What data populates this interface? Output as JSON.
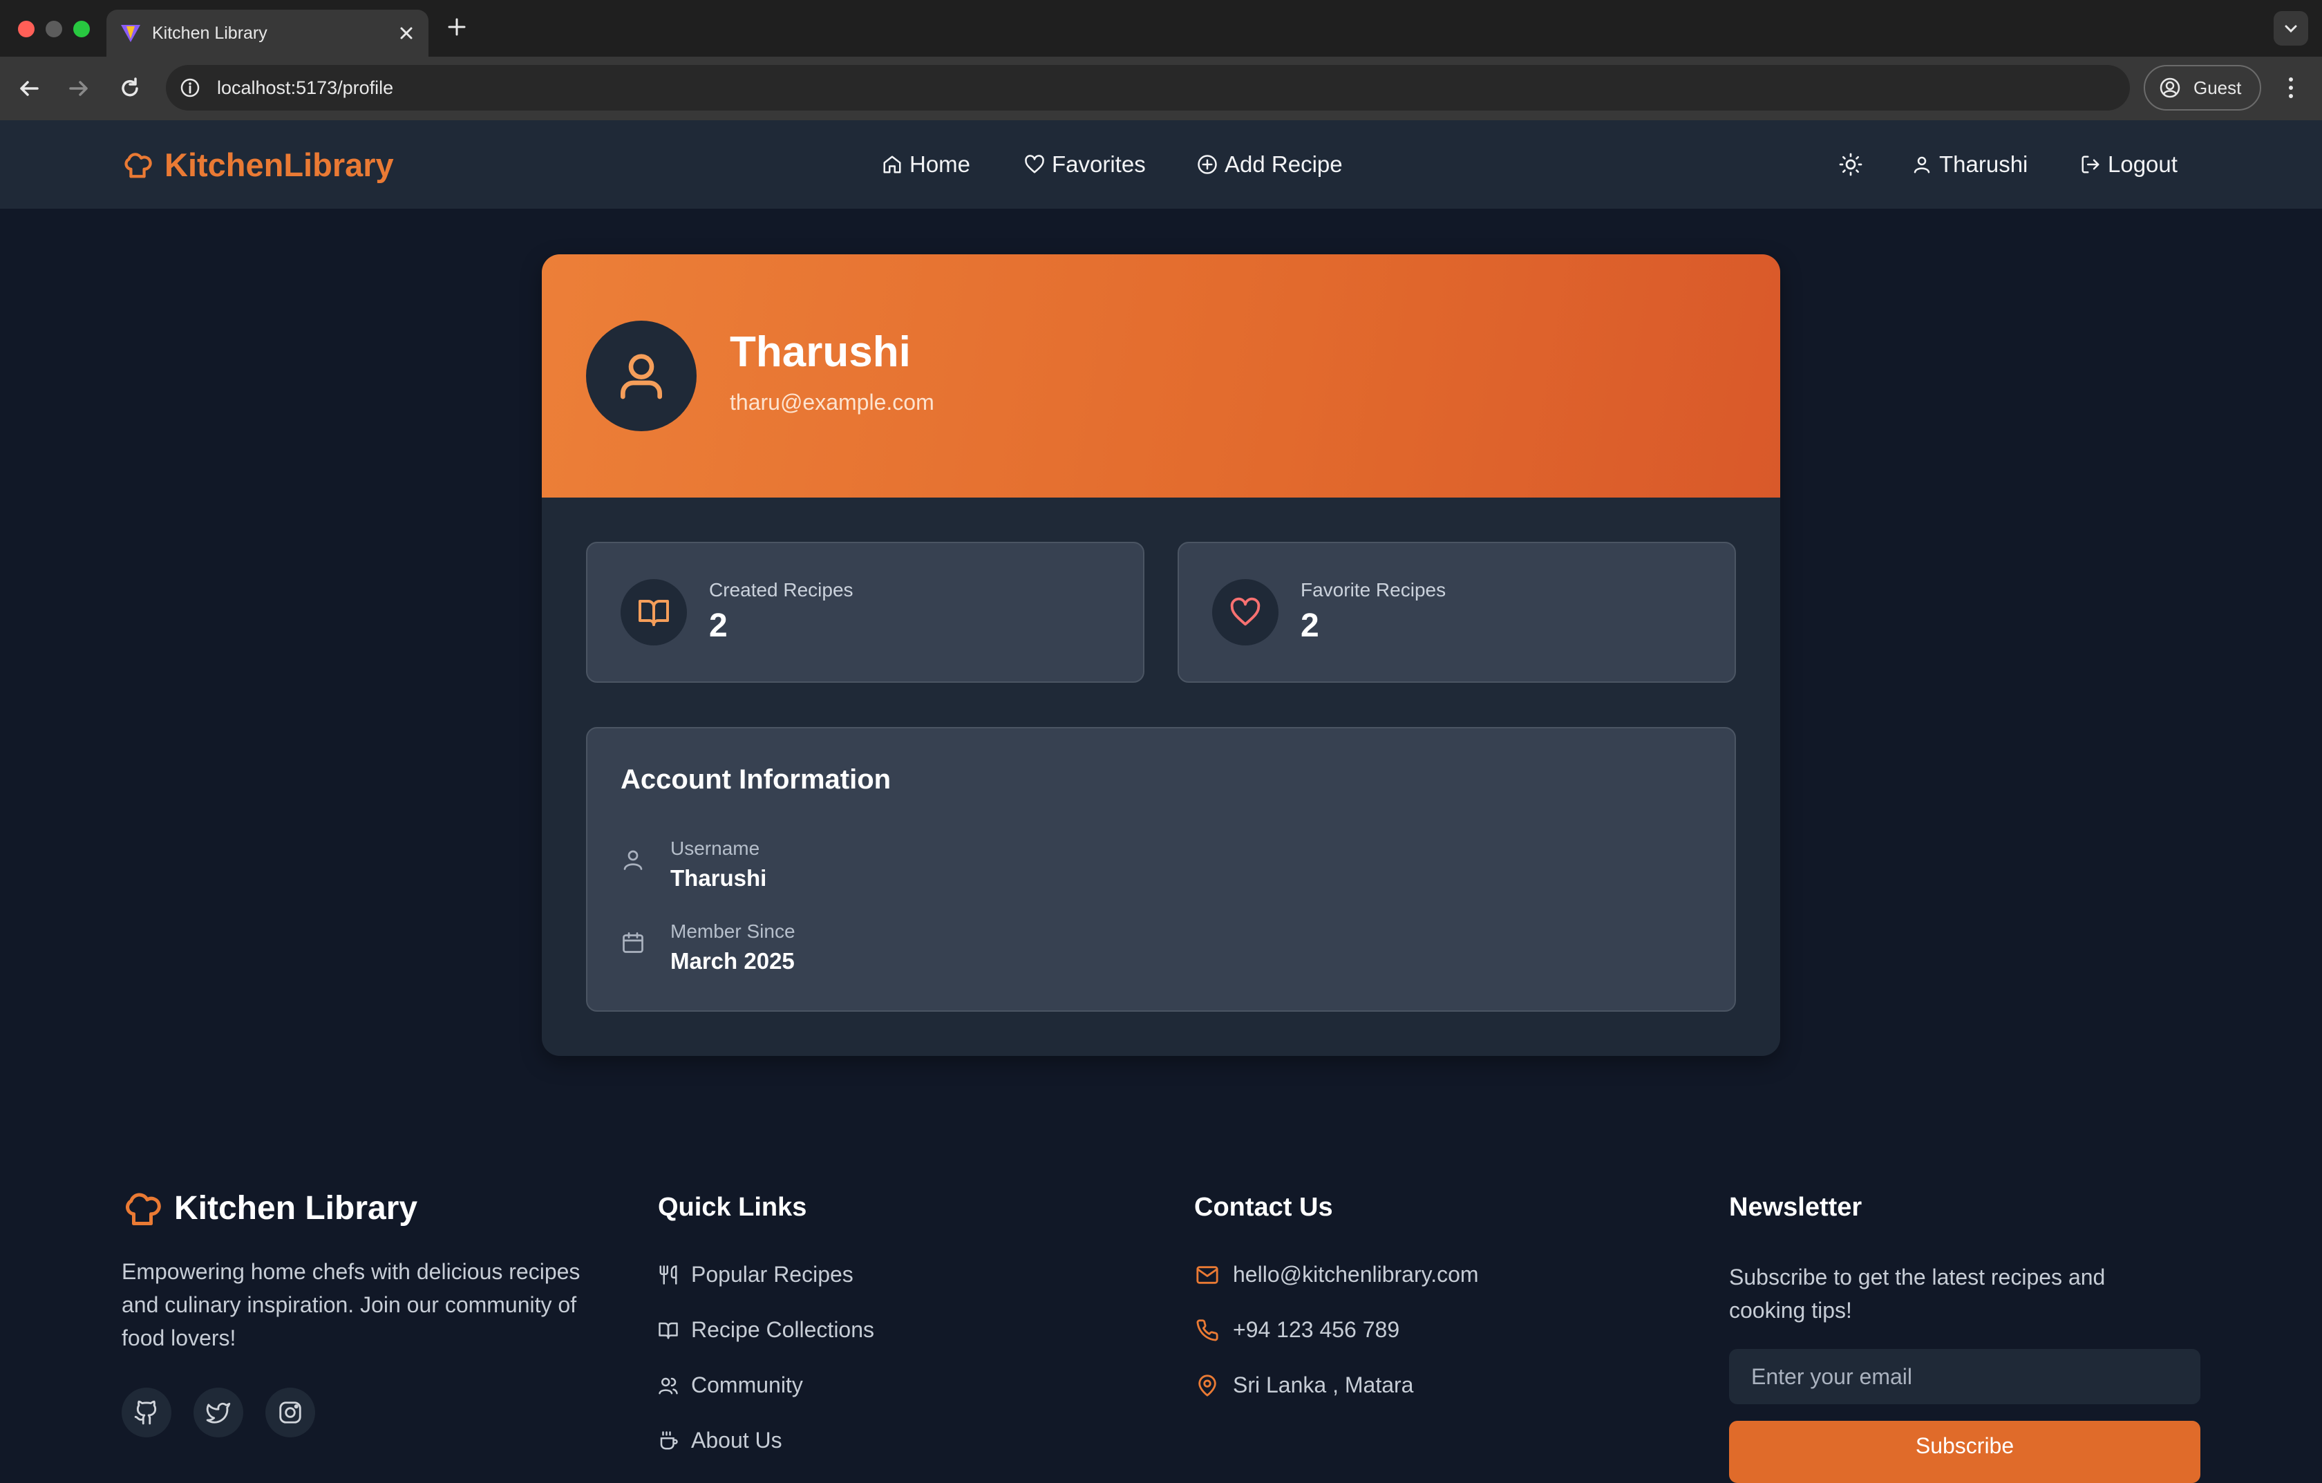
{
  "browser": {
    "tab_title": "Kitchen Library",
    "url": "localhost:5173/profile",
    "profile_label": "Guest"
  },
  "nav": {
    "brand": "KitchenLibrary",
    "links": [
      "Home",
      "Favorites",
      "Add Recipe"
    ],
    "user": "Tharushi",
    "logout": "Logout"
  },
  "profile": {
    "name": "Tharushi",
    "email": "tharu@example.com",
    "stats": [
      {
        "label": "Created Recipes",
        "value": "2"
      },
      {
        "label": "Favorite Recipes",
        "value": "2"
      }
    ],
    "account": {
      "title": "Account Information",
      "rows": [
        {
          "label": "Username",
          "value": "Tharushi"
        },
        {
          "label": "Member Since",
          "value": "March 2025"
        }
      ]
    }
  },
  "footer": {
    "brand": "Kitchen Library",
    "tagline_lines": [
      "Empowering home chefs with delicious recipes",
      "and culinary inspiration. Join our community of",
      "food lovers!"
    ],
    "quick_links": {
      "title": "Quick Links",
      "items": [
        "Popular Recipes",
        "Recipe Collections",
        "Community",
        "About Us"
      ]
    },
    "contact": {
      "title": "Contact Us",
      "email": "hello@kitchenlibrary.com",
      "phone": "+94 123 456 789",
      "location": "Sri Lanka , Matara"
    },
    "newsletter": {
      "title": "Newsletter",
      "text_lines": [
        "Subscribe to get the latest recipes and",
        "cooking tips!"
      ],
      "placeholder": "Enter your email",
      "button": "Subscribe"
    }
  },
  "colors": {
    "accent": "#ea7a34",
    "page_bg": "#111827",
    "nav_bg": "#1f2937",
    "card_bg": "#374151"
  }
}
